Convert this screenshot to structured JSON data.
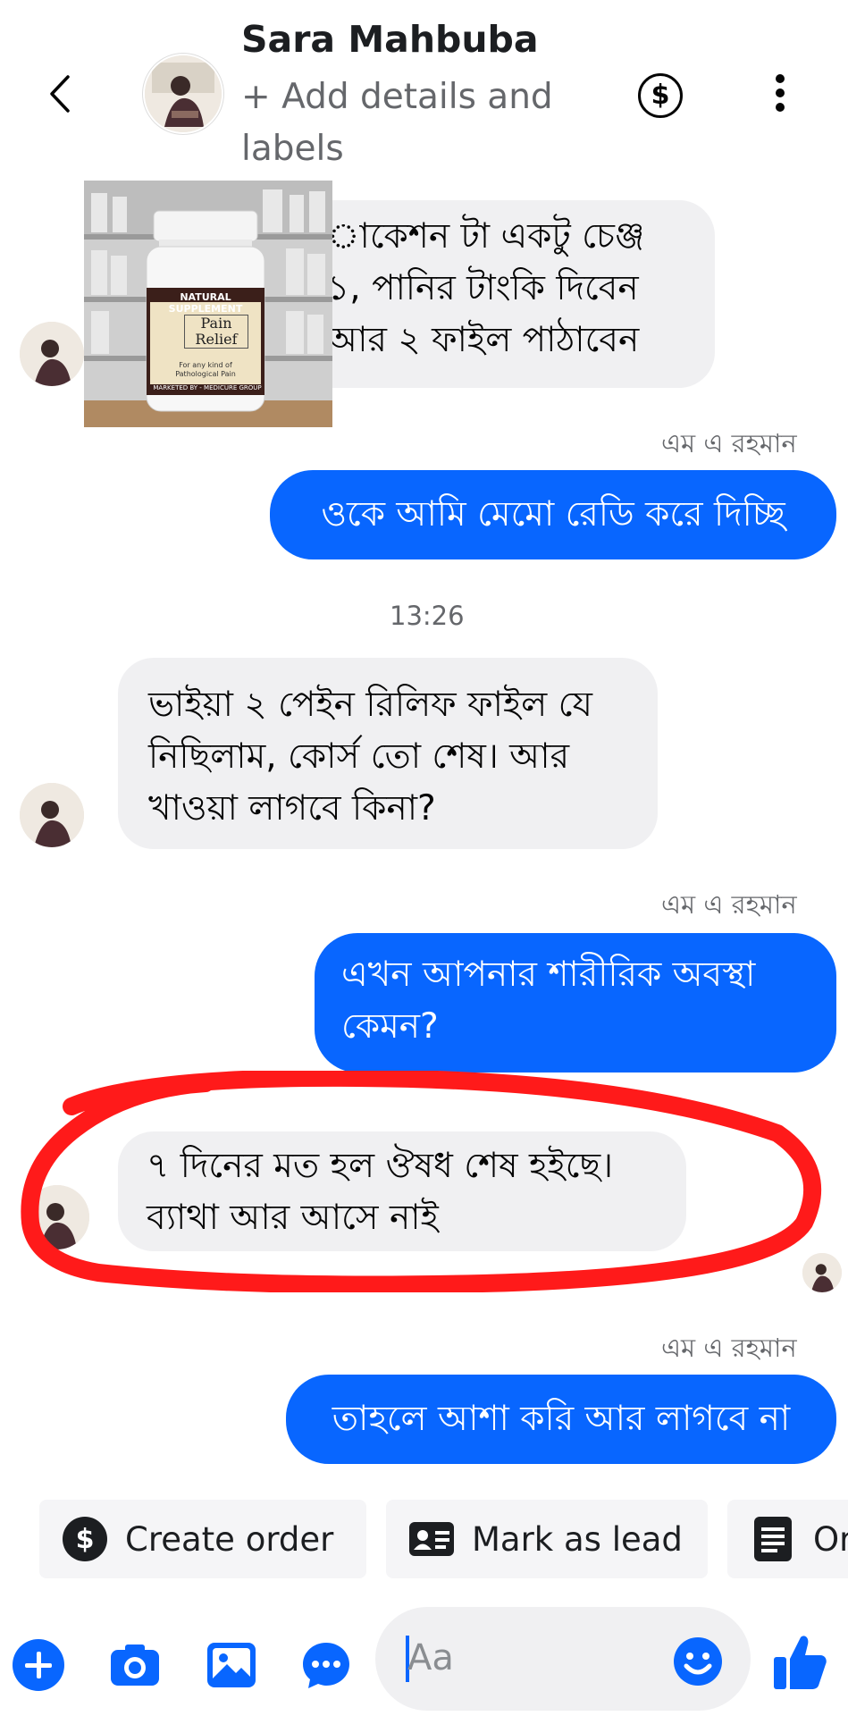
{
  "header": {
    "contact_name": "Sara Mahbuba",
    "subtitle": "+ Add details and labels"
  },
  "messages": [
    {
      "from": "in",
      "text": "ুাকেশন টা একটু চেঞ্জ ১, পানির টাংকি দিবেন আর ২ ফাইল পাঠাবেন",
      "lines": [
        "াকেশন টা একটু চেঞ্জ",
        "১, পানির টাংকি দিবেন",
        "আর ২ ফাইল পাঠাবেন"
      ]
    },
    {
      "sender": "এম এ রহমান"
    },
    {
      "from": "out",
      "text": "ওকে আমি মেমো রেডি করে দিচ্ছি"
    },
    {
      "timestamp": "13:26"
    },
    {
      "from": "in",
      "lines": [
        "ভাইয়া ২ পেইন রিলিফ ফাইল যে",
        "নিছিলাম, কোর্স তো শেষ। আর",
        "খাওয়া লাগবে কিনা?"
      ]
    },
    {
      "sender": "এম এ রহমান"
    },
    {
      "from": "out",
      "lines": [
        "এখন আপনার শারীরিক অবস্থা",
        "কেমন?"
      ]
    },
    {
      "from": "in",
      "lines": [
        "৭ দিনের মত হল ঔষধ শেষ হইছে।",
        "ব্যাথা আর আসে নাই"
      ]
    },
    {
      "sender": "এম এ রহমান"
    },
    {
      "from": "out",
      "text": "তাহলে আশা করি আর লাগবে না"
    }
  ],
  "attachment": {
    "brand_line": "NATURAL SUPPLEMENT",
    "product_line1": "Pain",
    "product_line2": "Relief",
    "desc_line1": "For any kind of",
    "desc_line2": "Pathological Pain",
    "marketed": "MARKETED BY - MEDICURE GROUP"
  },
  "actions": {
    "create_order": "Create order",
    "mark_as_lead": "Mark as lead",
    "third": "Or"
  },
  "composer": {
    "placeholder": "Aa"
  },
  "colors": {
    "accent": "#0866ff",
    "incoming_bubble": "#f0f0f2",
    "annotation": "#ff1a1a"
  },
  "icons": [
    "back-arrow-icon",
    "dollar-circle-icon",
    "more-vertical-icon",
    "plus-icon",
    "camera-icon",
    "image-icon",
    "chat-bubble-icon",
    "emoji-icon",
    "thumbs-up-icon",
    "id-card-icon",
    "document-icon"
  ]
}
